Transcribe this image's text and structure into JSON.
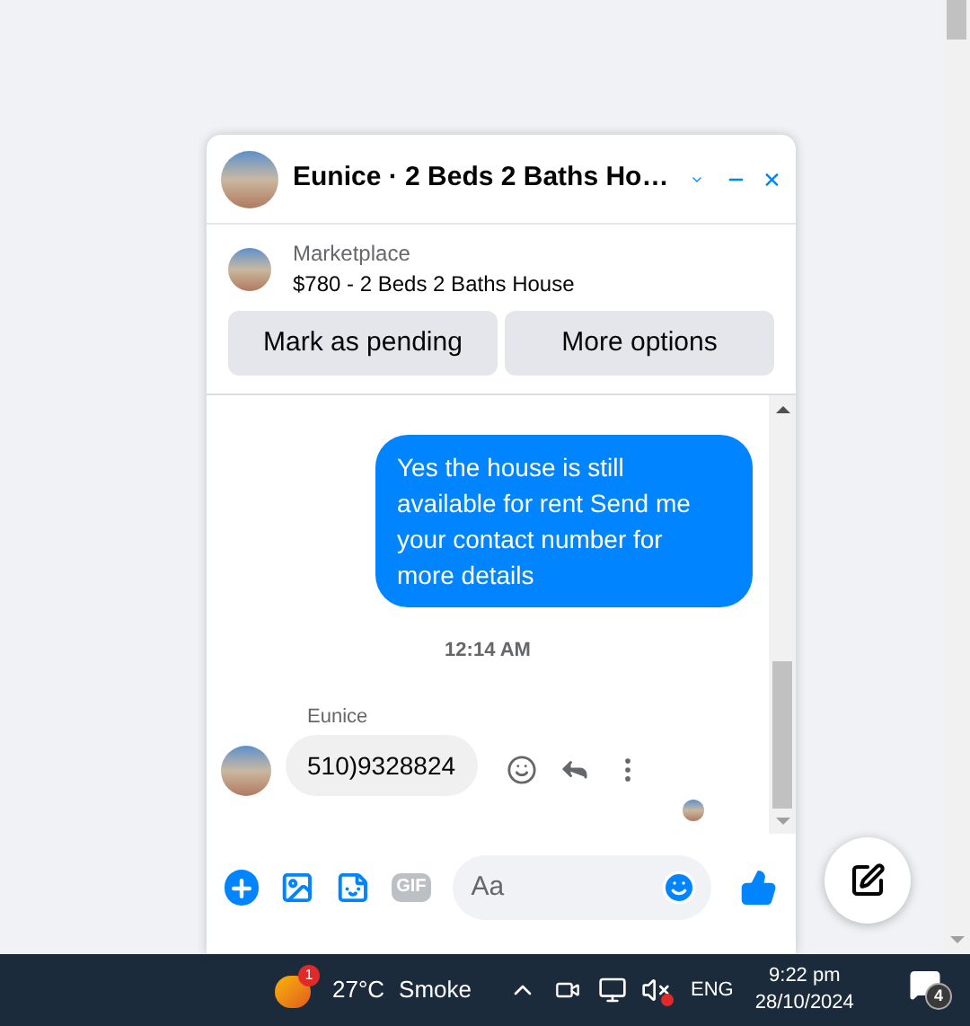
{
  "chat": {
    "title": "Eunice · 2 Beds 2 Baths Ho…"
  },
  "listing": {
    "source": "Marketplace",
    "title": "$780 - 2 Beds 2 Baths House"
  },
  "actions": [
    "Mark as pending",
    "More options"
  ],
  "messages": [
    {
      "kind": "outgoing",
      "text": "Yes the house is still available for rent Send me your contact number for more details"
    },
    {
      "kind": "timestamp",
      "text": "12:14 AM"
    },
    {
      "kind": "incoming",
      "sender": "Eunice",
      "text": "510)9328824"
    }
  ],
  "composer": {
    "gif_label": "GIF",
    "placeholder": "Aa"
  },
  "taskbar": {
    "weather_badge": "1",
    "temperature": "27°C",
    "weather": "Smoke",
    "language": "ENG",
    "time": "9:22 pm",
    "date": "28/10/2024",
    "notifications": "4"
  }
}
